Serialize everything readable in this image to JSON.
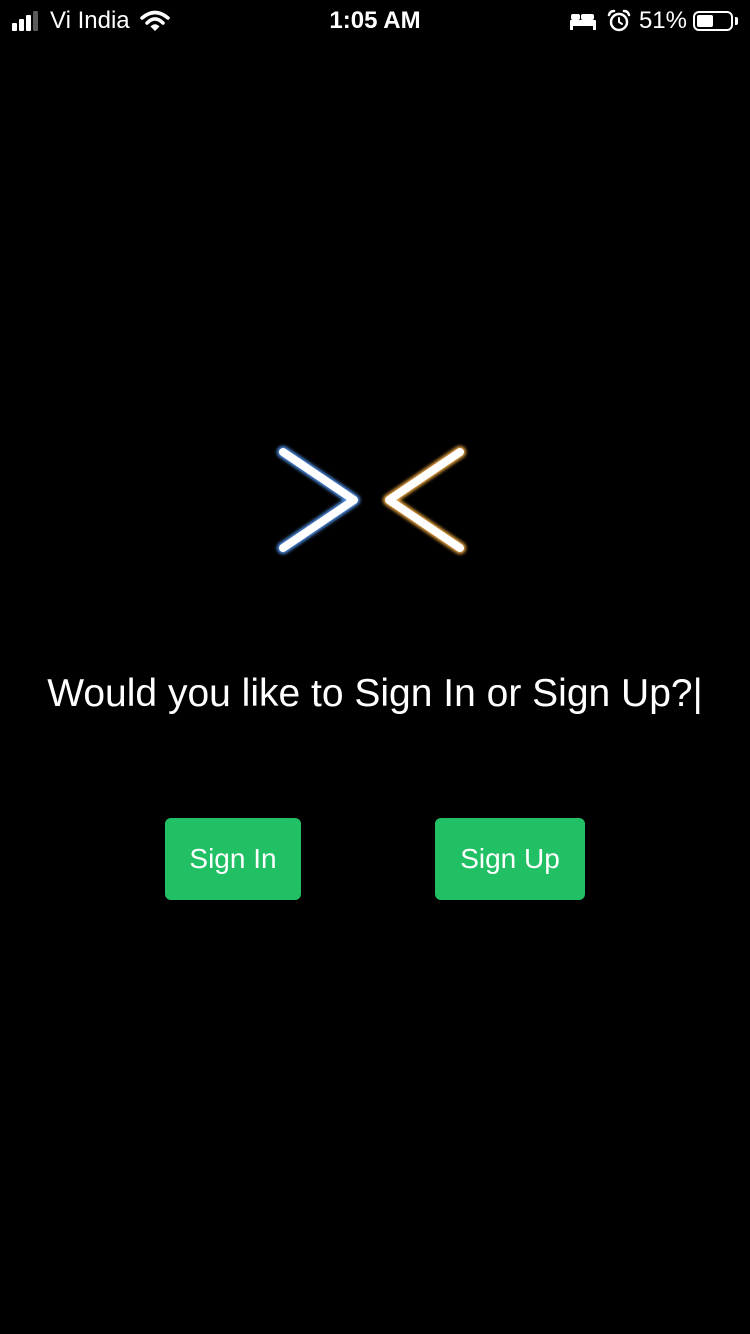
{
  "status_bar": {
    "carrier": "Vi India",
    "time": "1:05 AM",
    "battery_percent_label": "51%",
    "battery_level": 0.51,
    "signal_bars_active": 3,
    "signal_bars_total": 4,
    "icons": [
      "signal-icon",
      "wifi-icon",
      "bed-icon",
      "alarm-icon",
      "battery-icon"
    ]
  },
  "logo": {
    "icon": "logo-chevrons",
    "color": "#ffffff"
  },
  "prompt": {
    "text": "Would you like to Sign In or Sign Up?|"
  },
  "actions": {
    "sign_in_label": "Sign In",
    "sign_up_label": "Sign Up",
    "button_color": "#22c065"
  }
}
